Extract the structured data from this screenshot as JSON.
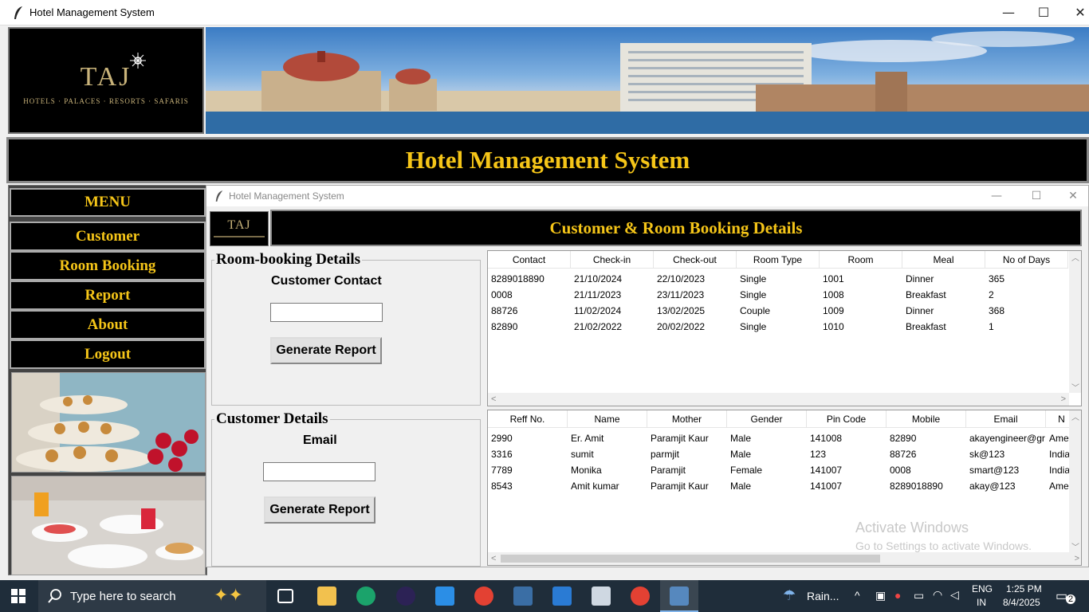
{
  "window": {
    "title": "Hotel Management System",
    "minimize": "—",
    "maximize": "☐",
    "close": "✕"
  },
  "logo": {
    "brand": "TAJ",
    "tagline": "HOTELS · PALACES · RESORTS · SAFARIS"
  },
  "header": {
    "title": "Hotel Management System"
  },
  "menu": {
    "heading": "MENU",
    "items": [
      "Customer",
      "Room Booking",
      "Report",
      "About",
      "Logout"
    ]
  },
  "inner_window": {
    "title": "Hotel Management System",
    "heading": "Customer & Room Booking Details",
    "small_logo": "TAJ"
  },
  "room_section": {
    "legend": "Room-booking Details",
    "label": "Customer Contact",
    "input_value": "",
    "button": "Generate Report"
  },
  "customer_section": {
    "legend": "Customer Details",
    "label": "Email",
    "input_value": "",
    "button": "Generate Report"
  },
  "room_table": {
    "columns": [
      "Contact",
      "Check-in",
      "Check-out",
      "Room Type",
      "Room",
      "Meal",
      "No of Days"
    ],
    "rows": [
      [
        "8289018890",
        "21/10/2024",
        "22/10/2023",
        "Single",
        "1001",
        "Dinner",
        "365"
      ],
      [
        "0008",
        "21/11/2023",
        "23/11/2023",
        "Single",
        "1008",
        "Breakfast",
        "2"
      ],
      [
        "88726",
        "11/02/2024",
        "13/02/2025",
        "Couple",
        "1009",
        "Dinner",
        "368"
      ],
      [
        "82890",
        "21/02/2022",
        "20/02/2022",
        "Single",
        "1010",
        "Breakfast",
        "1"
      ]
    ]
  },
  "customer_table": {
    "columns": [
      "Reff No.",
      "Name",
      "Mother",
      "Gender",
      "Pin Code",
      "Mobile",
      "Email",
      "N"
    ],
    "rows": [
      [
        "2990",
        "Er. Amit",
        "Paramjit Kaur",
        "Male",
        "141008",
        "82890",
        "akayengineer@gr",
        "Ame"
      ],
      [
        "3316",
        "sumit",
        "parmjit",
        "Male",
        "123",
        "88726",
        "sk@123",
        "India"
      ],
      [
        "7789",
        "Monika",
        "Paramjit",
        "Female",
        "141007",
        "0008",
        "smart@123",
        "India"
      ],
      [
        "8543",
        "Amit kumar",
        "Paramjit Kaur",
        "Male",
        "141007",
        "8289018890",
        "akay@123",
        "Ame"
      ]
    ]
  },
  "watermark": {
    "line1": "Activate Windows",
    "line2": "Go to Settings to activate Windows."
  },
  "taskbar": {
    "search_placeholder": "Type here to search",
    "weather": "Rain...",
    "lang1": "ENG",
    "lang2": "IN",
    "time": "1:25 PM",
    "date": "8/4/2025",
    "notif_count": "2"
  }
}
